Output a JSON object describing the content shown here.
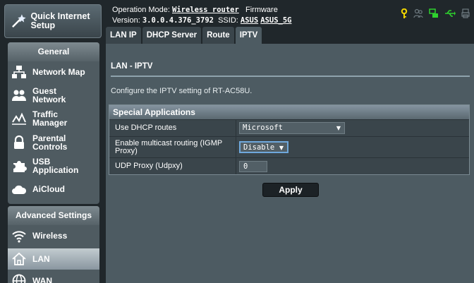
{
  "sidebar": {
    "quick_setup": "Quick Internet Setup",
    "general_header": "General",
    "general_items": [
      {
        "label": "Network Map",
        "icon": "network-map-icon"
      },
      {
        "label": "Guest Network",
        "icon": "guest-network-icon"
      },
      {
        "label": "Traffic Manager",
        "icon": "traffic-manager-icon"
      },
      {
        "label": "Parental Controls",
        "icon": "lock-icon"
      },
      {
        "label": "USB Application",
        "icon": "puzzle-icon"
      },
      {
        "label": "AiCloud",
        "icon": "cloud-icon"
      }
    ],
    "advanced_header": "Advanced Settings",
    "advanced_items": [
      {
        "label": "Wireless",
        "icon": "wifi-icon"
      },
      {
        "label": "LAN",
        "icon": "home-icon"
      },
      {
        "label": "WAN",
        "icon": "globe-icon"
      }
    ]
  },
  "header": {
    "operation_mode_label": "Operation Mode:",
    "operation_mode_value": "Wireless router",
    "firmware_label": "Firmware",
    "version_label": "Version:",
    "version_value": "3.0.0.4.376_3792",
    "ssid_label": "SSID:",
    "ssid_1": "ASUS",
    "ssid_2": "ASUS_5G"
  },
  "tabs": [
    "LAN IP",
    "DHCP Server",
    "Route",
    "IPTV"
  ],
  "content": {
    "title": "LAN - IPTV",
    "description": "Configure the IPTV setting of RT-AC58U.",
    "section_title": "Special Applications",
    "rows": [
      {
        "label": "Use DHCP routes",
        "value": "Microsoft"
      },
      {
        "label": "Enable multicast routing (IGMP Proxy)",
        "value": "Disable"
      },
      {
        "label": "UDP Proxy (Udpxy)",
        "value": "0"
      }
    ],
    "apply_label": "Apply"
  },
  "colors": {
    "background": "#20272b",
    "content_bg": "#4d5b62",
    "status_yellow": "#f2d600",
    "status_green": "#2ed12e"
  }
}
